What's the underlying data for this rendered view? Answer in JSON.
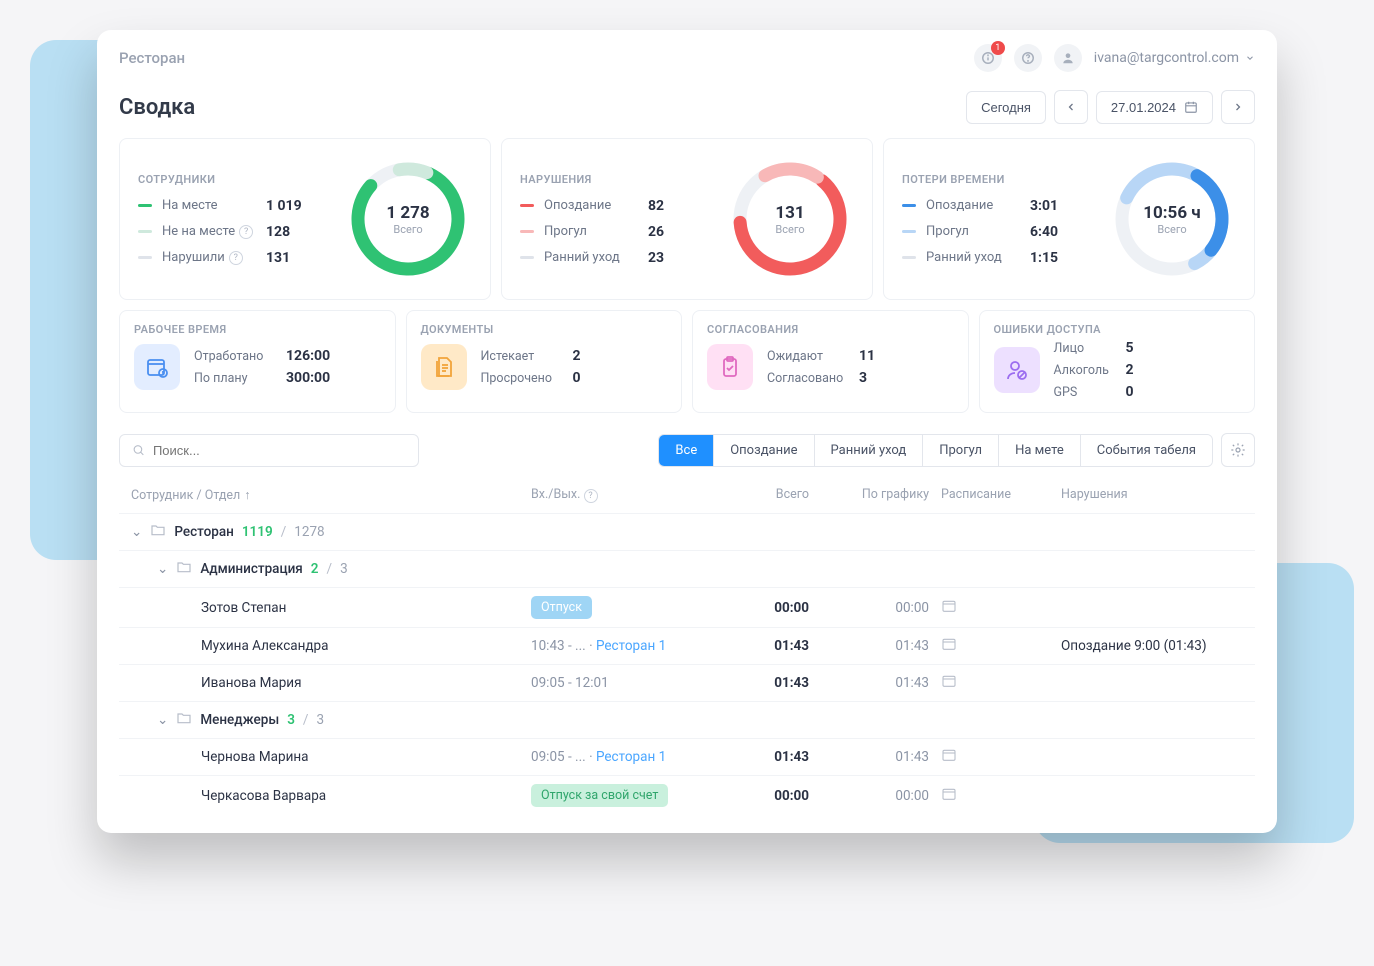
{
  "top": {
    "app_title": "Ресторан",
    "notif_badge": "1",
    "user_email": "ivana@targcontrol.com"
  },
  "header": {
    "page_title": "Сводка",
    "today_btn": "Сегодня",
    "date": "27.01.2024"
  },
  "cards": {
    "employees": {
      "title": "СОТРУДНИКИ",
      "items": [
        {
          "label": "На месте",
          "value": "1 019",
          "color": "#2fc273",
          "q": false
        },
        {
          "label": "Не на месте",
          "value": "128",
          "color": "#cfe9dd",
          "q": true
        },
        {
          "label": "Нарушили",
          "value": "131",
          "color": "#dfe3ea",
          "q": true
        }
      ],
      "donut_big": "1 278",
      "donut_sub": "Всего"
    },
    "violations": {
      "title": "НАРУШЕНИЯ",
      "items": [
        {
          "label": "Опоздание",
          "value": "82",
          "color": "#f25c5c"
        },
        {
          "label": "Прогул",
          "value": "26",
          "color": "#f8b8b8"
        },
        {
          "label": "Ранний уход",
          "value": "23",
          "color": "#dfe3ea"
        }
      ],
      "donut_big": "131",
      "donut_sub": "Всего"
    },
    "timeloss": {
      "title": "ПОТЕРИ ВРЕМЕНИ",
      "items": [
        {
          "label": "Опоздание",
          "value": "3:01",
          "color": "#3c8fe8"
        },
        {
          "label": "Прогул",
          "value": "6:40",
          "color": "#b8d6f6"
        },
        {
          "label": "Ранний уход",
          "value": "1:15",
          "color": "#dfe3ea"
        }
      ],
      "donut_big": "10:56 ч",
      "donut_sub": "Всего"
    }
  },
  "cards4": {
    "worktime": {
      "title": "РАБОЧЕЕ ВРЕМЯ",
      "rows": [
        {
          "label": "Отработано",
          "value": "126:00"
        },
        {
          "label": "По плану",
          "value": "300:00"
        }
      ]
    },
    "docs": {
      "title": "ДОКУМЕНТЫ",
      "rows": [
        {
          "label": "Истекает",
          "value": "2"
        },
        {
          "label": "Просрочено",
          "value": "0"
        }
      ]
    },
    "approvals": {
      "title": "СОГЛАСОВАНИЯ",
      "rows": [
        {
          "label": "Ожидают",
          "value": "11"
        },
        {
          "label": "Согласовано",
          "value": "3"
        }
      ]
    },
    "accesserrors": {
      "title": "ОШИБКИ ДОСТУПА",
      "rows": [
        {
          "label": "Лицо",
          "value": "5"
        },
        {
          "label": "Алкоголь",
          "value": "2"
        },
        {
          "label": "GPS",
          "value": "0"
        }
      ]
    }
  },
  "filters": {
    "search_placeholder": "Поиск...",
    "tabs": [
      "Все",
      "Опоздание",
      "Ранний уход",
      "Прогул",
      "На мете",
      "События табеля"
    ]
  },
  "table": {
    "headers": {
      "employee": "Сотрудник / Отдел",
      "inout": "Вх./Вых.",
      "total": "Всего",
      "bysched": "По графику",
      "schedule": "Расписание",
      "violations": "Нарушения"
    },
    "groups": [
      {
        "name": "Ресторан",
        "present": "1119",
        "total": "1278",
        "indent": 0
      },
      {
        "name": "Администрация",
        "present": "2",
        "total": "3",
        "indent": 1
      }
    ],
    "rows1": [
      {
        "name": "Зотов Степан",
        "tag": "Отпуск",
        "tag_cls": "tag-blue",
        "total": "00:00",
        "sched": "00:00",
        "viol": ""
      },
      {
        "name": "Мухина Александра",
        "inout": "10:43 - ... · ",
        "loc": "Ресторан 1",
        "total": "01:43",
        "sched": "01:43",
        "viol": "Опоздание 9:00 (01:43)"
      },
      {
        "name": "Иванова Мария",
        "inout": "09:05 - 12:01",
        "total": "01:43",
        "sched": "01:43",
        "viol": ""
      }
    ],
    "group2": {
      "name": "Менеджеры",
      "present": "3",
      "total": "3",
      "indent": 1
    },
    "rows2": [
      {
        "name": "Чернова Марина",
        "inout": "09:05 - ... · ",
        "loc": "Ресторан 1",
        "total": "01:43",
        "sched": "01:43",
        "viol": ""
      },
      {
        "name": "Черкасова Варвара",
        "tag": "Отпуск за свой счет",
        "tag_cls": "tag-green",
        "total": "00:00",
        "sched": "00:00",
        "viol": ""
      }
    ]
  }
}
